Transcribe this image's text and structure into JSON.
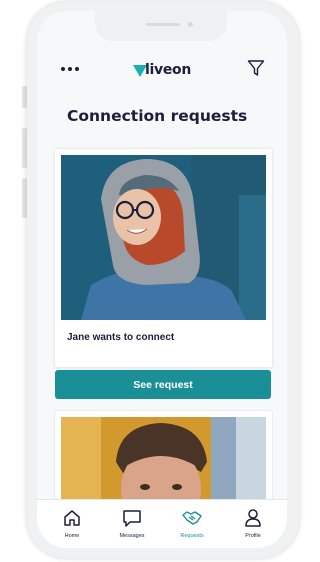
{
  "app": {
    "brand": "liveon"
  },
  "page": {
    "title": "Connection requests"
  },
  "requests": [
    {
      "text": "Jane wants to connect",
      "button_label": "See request"
    }
  ],
  "tabs": [
    {
      "label": "Home",
      "icon": "home-icon",
      "active": false
    },
    {
      "label": "Messages",
      "icon": "message-icon",
      "active": false
    },
    {
      "label": "Requests",
      "icon": "handshake-icon",
      "active": true
    },
    {
      "label": "Profile",
      "icon": "user-icon",
      "active": false
    }
  ],
  "colors": {
    "accent": "#1b8f97",
    "logo_mark": "#1ab0b3",
    "text": "#1b1f3b"
  }
}
